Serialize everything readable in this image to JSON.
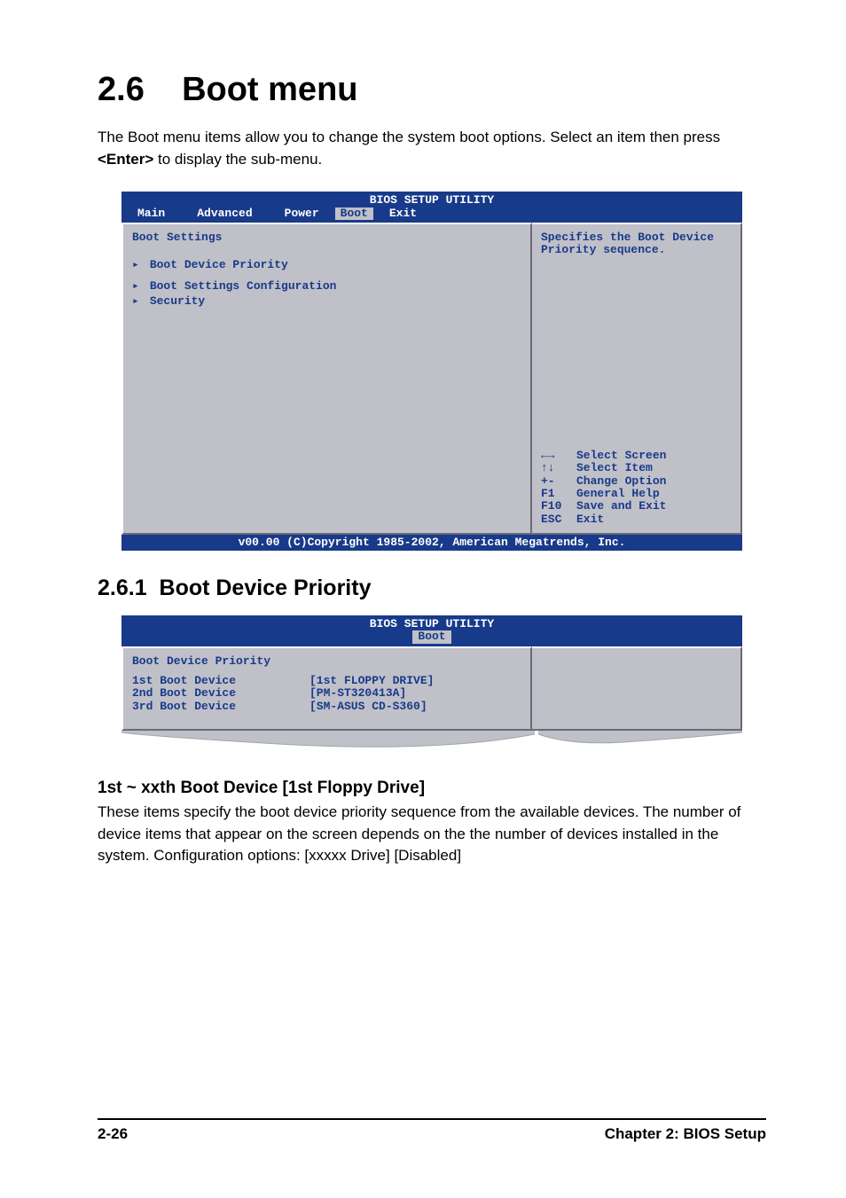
{
  "heading": {
    "number": "2.6",
    "title": "Boot menu"
  },
  "intro": {
    "part1": "The Boot menu items allow you to change the system boot options. Select an item then press ",
    "enter": "<Enter>",
    "part2": " to display the sub-menu."
  },
  "bios1": {
    "title": "BIOS SETUP UTILITY",
    "tabs": [
      "Main",
      "Advanced",
      "Power",
      "Boot",
      "Exit"
    ],
    "active_tab_index": 3,
    "left_header": "Boot Settings",
    "items": [
      "Boot Device Priority",
      "Boot Settings Configuration",
      "Security"
    ],
    "help_text": "Specifies the Boot Device Priority sequence.",
    "keys": [
      {
        "k": "←→",
        "d": "Select Screen"
      },
      {
        "k": "↑↓",
        "d": "Select Item"
      },
      {
        "k": "+-",
        "d": "Change Option"
      },
      {
        "k": "F1",
        "d": "General Help"
      },
      {
        "k": "F10",
        "d": "Save and Exit"
      },
      {
        "k": "ESC",
        "d": "Exit"
      }
    ],
    "footer": "v00.00 (C)Copyright 1985-2002, American Megatrends, Inc."
  },
  "subsection": {
    "number": "2.6.1",
    "title": "Boot Device Priority"
  },
  "bios2": {
    "title": "BIOS SETUP UTILITY",
    "active_tab": "Boot",
    "header": "Boot Device Priority",
    "rows": [
      {
        "label": "1st Boot Device",
        "value": "[1st FLOPPY DRIVE]"
      },
      {
        "label": "2nd Boot Device",
        "value": "[PM-ST320413A]"
      },
      {
        "label": "3rd Boot Device",
        "value": "[SM-ASUS CD-S360]"
      }
    ]
  },
  "option": {
    "title": "1st ~ xxth Boot Device [1st Floppy Drive]",
    "body": "These items specify the boot device priority sequence from the available devices. The number of device items that appear on the screen depends on the the number of devices installed in the system. Configuration options: [xxxxx Drive] [Disabled]"
  },
  "page_footer": {
    "left": "2-26",
    "right": "Chapter 2: BIOS Setup"
  }
}
